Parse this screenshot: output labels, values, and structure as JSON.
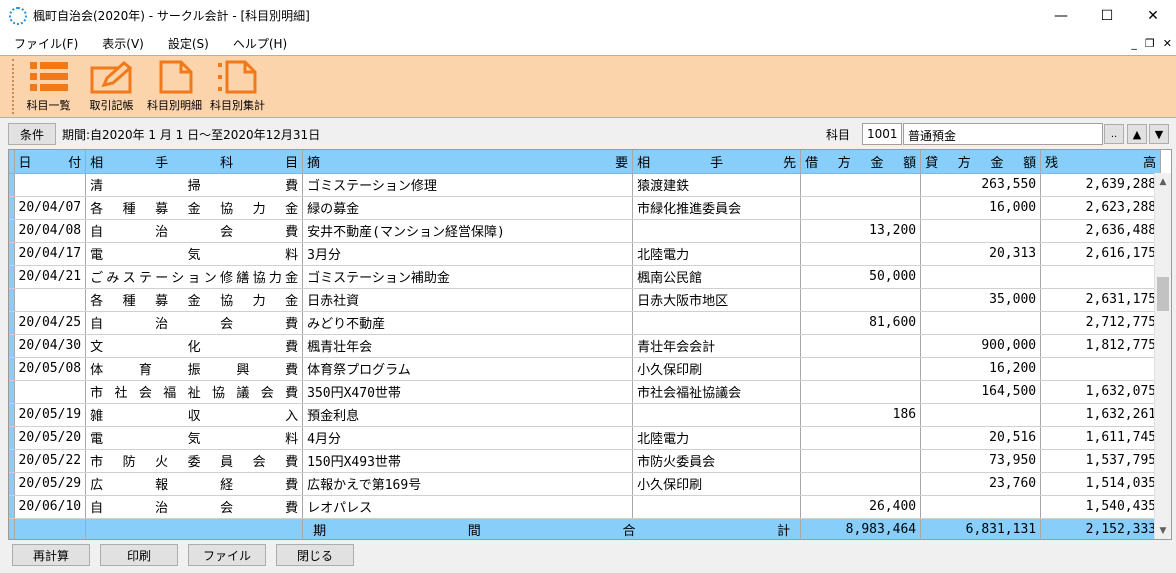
{
  "window": {
    "title": "楓町自治会(2020年) - サークル会計 - [科目別明細]",
    "minimize": "—",
    "maximize": "☐",
    "close": "✕"
  },
  "menu": {
    "items": [
      "ファイル(F)",
      "表示(V)",
      "設定(S)",
      "ヘルプ(H)"
    ],
    "mdi_min": "_",
    "mdi_restore": "❐",
    "mdi_close": "✕"
  },
  "toolbar": {
    "items": [
      {
        "label": "科目一覧",
        "icon": "list-icon"
      },
      {
        "label": "取引記帳",
        "icon": "edit-icon"
      },
      {
        "label": "科目別明細",
        "icon": "document-icon"
      },
      {
        "label": "科目別集計",
        "icon": "document-list-icon"
      }
    ]
  },
  "condition": {
    "button": "条件",
    "period": "期間:自2020年 1 月 1 日～至2020年12月31日",
    "account_label": "科目",
    "account_code": "1001",
    "account_name": "普通預金",
    "lookup": "..",
    "up": "▲",
    "down": "▼"
  },
  "colors": {
    "header_bg": "#87cefa",
    "toolbar_bg": "#fcd4ac",
    "toolbar_icon": "#f07a1a"
  },
  "table": {
    "headers": [
      "日付",
      "相手科目",
      "摘要",
      "相手先",
      "借方金額",
      "貸方金額",
      "残高"
    ],
    "rows": [
      [
        "",
        "清掃費",
        "ゴミステーション修理",
        "猿渡建鉄",
        "",
        "263,550",
        "2,639,288"
      ],
      [
        "20/04/07",
        "各種募金協力金",
        "緑の募金",
        "市緑化推進委員会",
        "",
        "16,000",
        "2,623,288"
      ],
      [
        "20/04/08",
        "自治会費",
        "安井不動産(マンション経営保障)",
        "",
        "13,200",
        "",
        "2,636,488"
      ],
      [
        "20/04/17",
        "電気料",
        "3月分",
        "北陸電力",
        "",
        "20,313",
        "2,616,175"
      ],
      [
        "20/04/21",
        "ごみステーション修繕協力金",
        "ゴミステーション補助金",
        "楓南公民館",
        "50,000",
        "",
        ""
      ],
      [
        "",
        "各種募金協力金",
        "日赤社資",
        "日赤大阪市地区",
        "",
        "35,000",
        "2,631,175"
      ],
      [
        "20/04/25",
        "自治会費",
        "みどり不動産",
        "",
        "81,600",
        "",
        "2,712,775"
      ],
      [
        "20/04/30",
        "文化費",
        "楓青壮年会",
        "青壮年会会計",
        "",
        "900,000",
        "1,812,775"
      ],
      [
        "20/05/08",
        "体育振興費",
        "体育祭プログラム",
        "小久保印刷",
        "",
        "16,200",
        ""
      ],
      [
        "",
        "市社会福祉協議会費",
        "350円X470世帯",
        "市社会福祉協議会",
        "",
        "164,500",
        "1,632,075"
      ],
      [
        "20/05/19",
        "雑収入",
        "預金利息",
        "",
        "186",
        "",
        "1,632,261"
      ],
      [
        "20/05/20",
        "電気料",
        "4月分",
        "北陸電力",
        "",
        "20,516",
        "1,611,745"
      ],
      [
        "20/05/22",
        "市防火委員会費",
        "150円X493世帯",
        "市防火委員会",
        "",
        "73,950",
        "1,537,795"
      ],
      [
        "20/05/29",
        "広報経費",
        "広報かえで第169号",
        "小久保印刷",
        "",
        "23,760",
        "1,514,035"
      ],
      [
        "20/06/10",
        "自治会費",
        "レオパレス",
        "",
        "26,400",
        "",
        "1,540,435"
      ]
    ],
    "total": {
      "label": "期間合計",
      "debit": "8,983,464",
      "credit": "6,831,131",
      "balance": "2,152,333"
    }
  },
  "footer": {
    "buttons": [
      "再計算",
      "印刷",
      "ファイル",
      "閉じる"
    ]
  }
}
